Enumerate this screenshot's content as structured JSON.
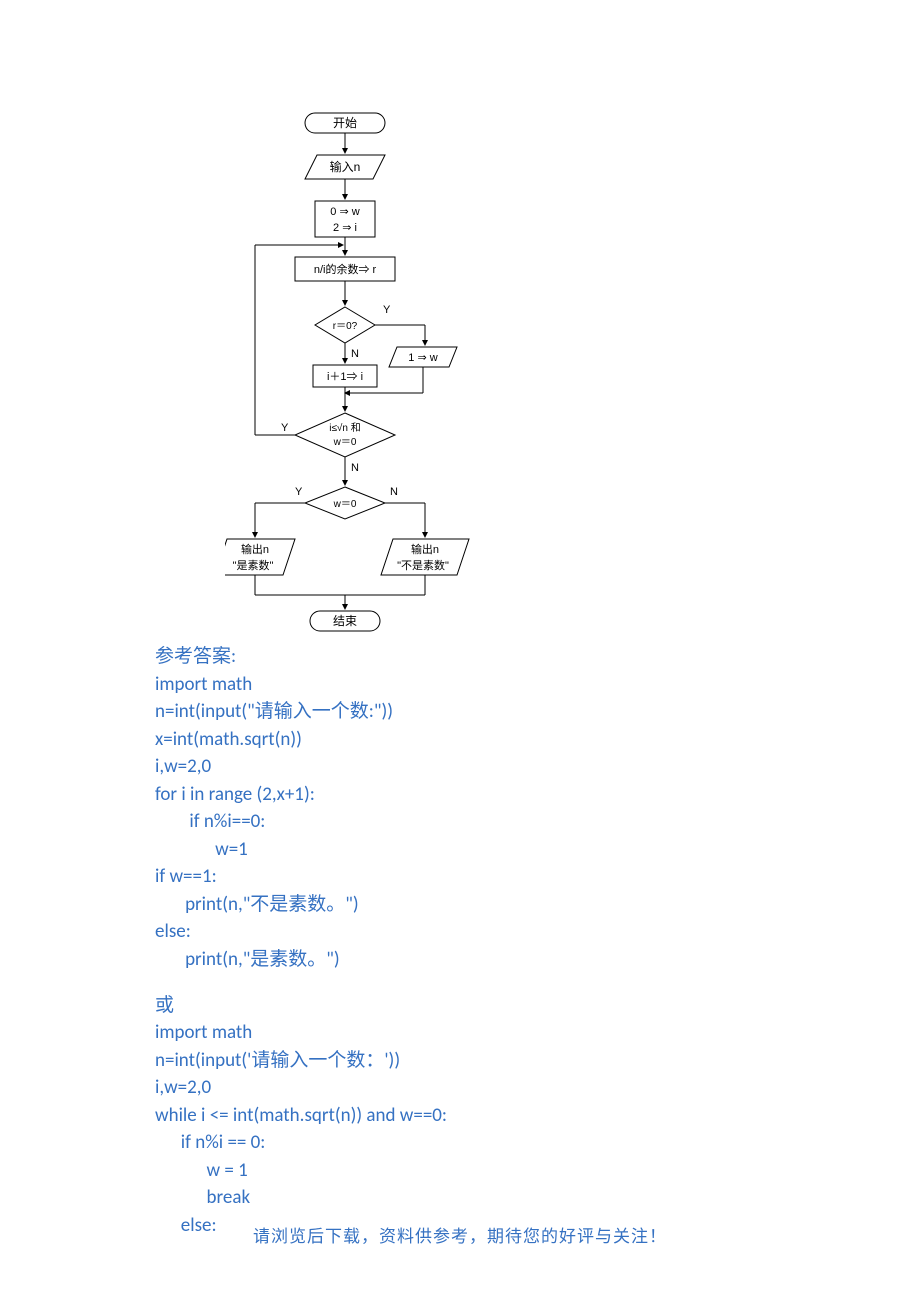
{
  "flowchart": {
    "start": "开始",
    "input": "输入n",
    "init_line1": "0 ⇒ w",
    "init_line2": "2 ⇒ i",
    "remainder": "n/i的余数⇒ r",
    "cond_r": "r＝0?",
    "yes_r": "Y",
    "no_r": "N",
    "set_w": "1 ⇒ w",
    "inc_i": "i＋1⇒ i",
    "loop_cond_line1": "i≤√n 和",
    "loop_cond_line2": "w＝0",
    "loop_yes": "Y",
    "loop_no": "N",
    "cond_w": "w＝0",
    "w_yes": "Y",
    "w_no": "N",
    "out_prime_line1": "输出n",
    "out_prime_line2": "\"是素数\"",
    "out_notprime_line1": "输出n",
    "out_notprime_line2": "\"不是素数\"",
    "end": "结束"
  },
  "answer_heading": "参考答案:",
  "code1": {
    "l1": "import math",
    "l2": "n=int(input(\"请输入一个数:\"))",
    "l3": "x=int(math.sqrt(n))",
    "l4": "i,w=2,0",
    "l5": "for i in range (2,x+1):",
    "l6": "        if n%i==0:",
    "l7": "              w=1",
    "l8": "if w==1:",
    "l9": "       print(n,\"不是素数。\")",
    "l10": "else:",
    "l11": "       print(n,\"是素数。\")"
  },
  "or_heading": "或",
  "code2": {
    "l1": "import math",
    "l2": "n=int(input('请输入一个数：'))",
    "l3": "i,w=2,0",
    "l4": "while i <= int(math.sqrt(n)) and w==0:",
    "l5": "      if n%i == 0:",
    "l6": "            w = 1",
    "l7": "            break",
    "l8": "      else:"
  },
  "footer": "请浏览后下载，资料供参考，期待您的好评与关注！"
}
